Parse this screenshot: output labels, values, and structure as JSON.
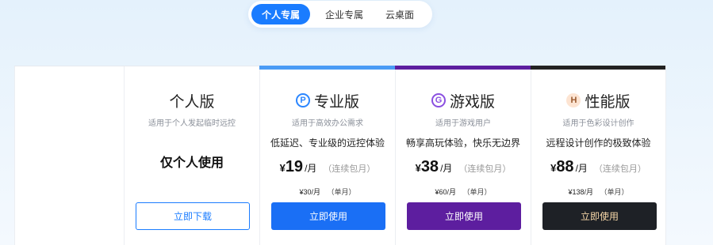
{
  "tabs": [
    {
      "label": "个人专属",
      "active": true
    },
    {
      "label": "企业专属",
      "active": false
    },
    {
      "label": "云桌面",
      "active": false
    }
  ],
  "personal": {
    "title": "个人版",
    "subtitle": "适用于个人发起临时远控",
    "main": "仅个人使用",
    "button": "立即下载"
  },
  "plans": [
    {
      "badge": "P",
      "title": "专业版",
      "subtitle": "适用于高效办公需求",
      "desc": "低延迟、专业级的远控体验",
      "currency": "¥",
      "price": "19",
      "unit": "/月",
      "note": "（连续包月）",
      "single_price": "¥30/月",
      "single_note": "（单月）",
      "button": "立即使用",
      "accent": "#2b86ff"
    },
    {
      "badge": "G",
      "title": "游戏版",
      "subtitle": "适用于游戏用户",
      "desc": "畅享高玩体验，快乐无边界",
      "currency": "¥",
      "price": "38",
      "unit": "/月",
      "note": "（连续包月）",
      "single_price": "¥60/月",
      "single_note": "（单月）",
      "button": "立即使用",
      "accent": "#5d1e9f"
    },
    {
      "badge": "H",
      "title": "性能版",
      "subtitle": "适用于色彩设计创作",
      "desc": "远程设计创作的极致体验",
      "currency": "¥",
      "price": "88",
      "unit": "/月",
      "note": "（连续包月）",
      "single_price": "¥138/月",
      "single_note": "（单月）",
      "button": "立即使用",
      "accent": "#222222"
    }
  ]
}
